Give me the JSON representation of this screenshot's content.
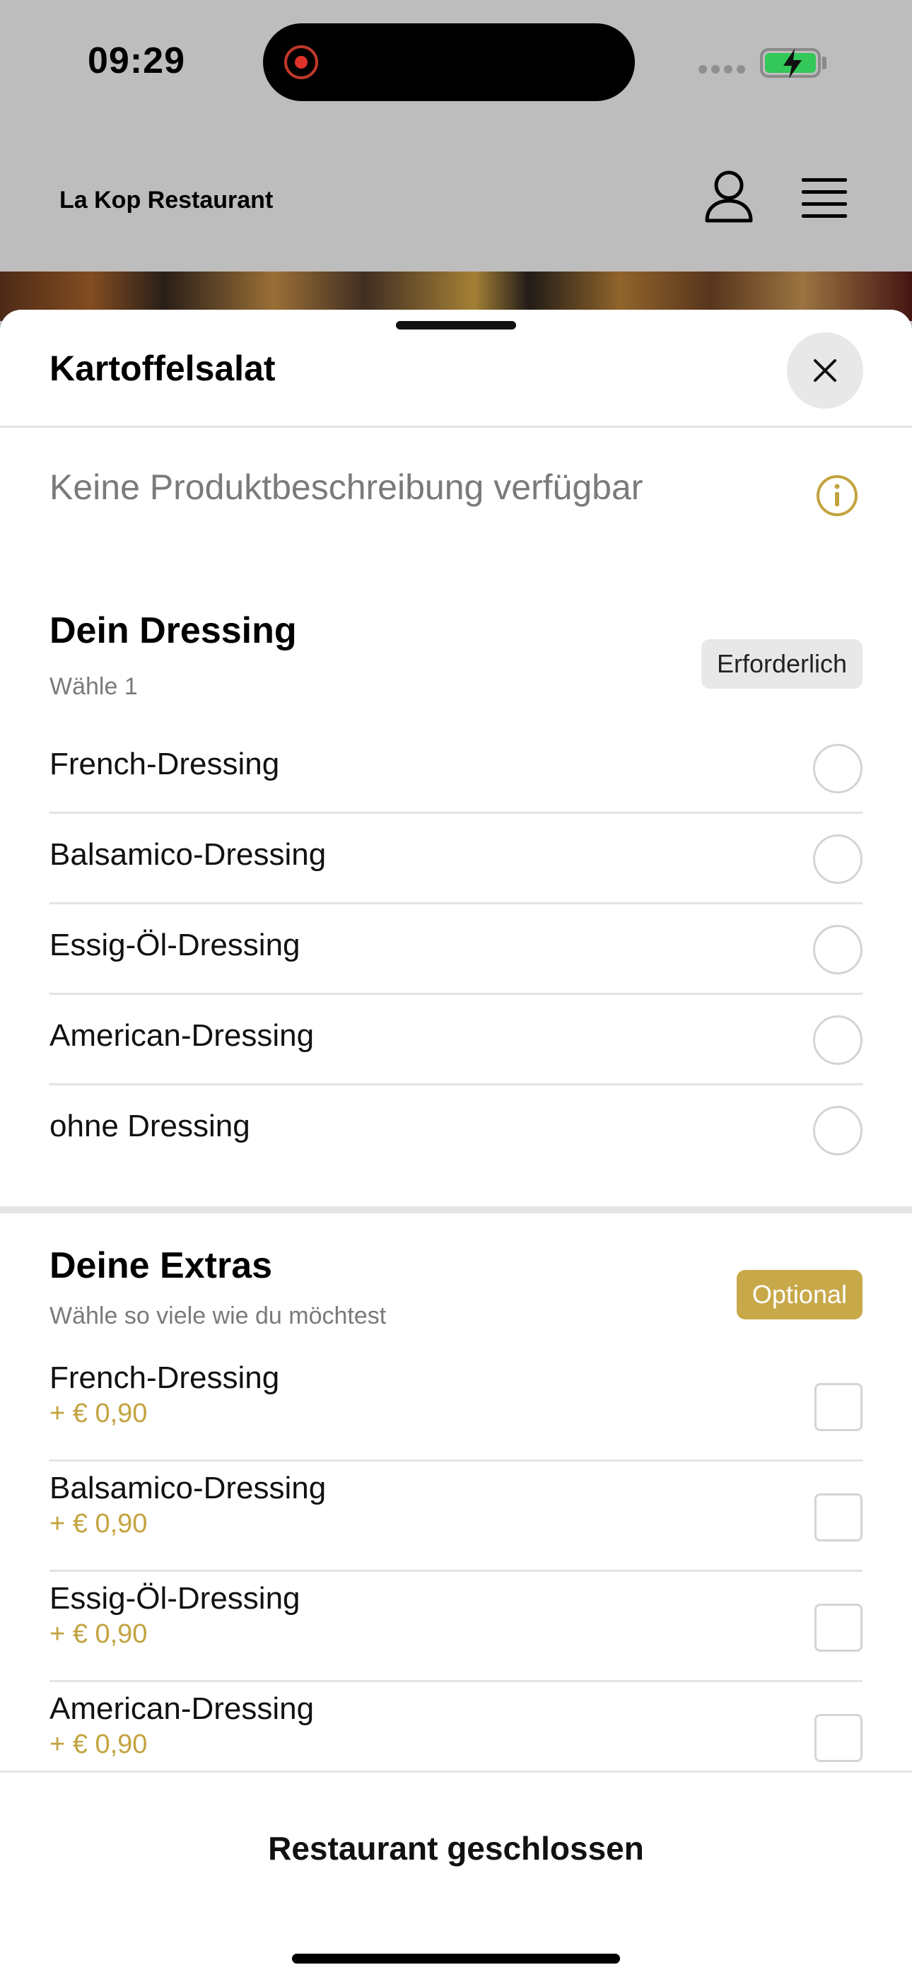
{
  "status_bar": {
    "time": "09:29"
  },
  "header": {
    "restaurant_name": "La Kop Restaurant",
    "user_icon": "user-icon",
    "menu_icon": "hamburger-menu-icon"
  },
  "sheet": {
    "title": "Kartoffelsalat",
    "close_icon": "close-icon",
    "description": "Keine Produktbeschreibung verfügbar",
    "info_icon": "info-icon"
  },
  "dressing_section": {
    "title": "Dein Dressing",
    "subtitle": "Wähle 1",
    "badge": "Erforderlich",
    "options": [
      {
        "label": "French-Dressing",
        "selected": false
      },
      {
        "label": "Balsamico-Dressing",
        "selected": false
      },
      {
        "label": "Essig-Öl-Dressing",
        "selected": false
      },
      {
        "label": "American-Dressing",
        "selected": false
      },
      {
        "label": "ohne Dressing",
        "selected": false
      }
    ]
  },
  "extras_section": {
    "title": "Deine Extras",
    "subtitle": "Wähle so viele wie du möchtest",
    "badge": "Optional",
    "options": [
      {
        "label": "French-Dressing",
        "price": "+ € 0,90",
        "checked": false
      },
      {
        "label": "Balsamico-Dressing",
        "price": "+ € 0,90",
        "checked": false
      },
      {
        "label": "Essig-Öl-Dressing",
        "price": "+ € 0,90",
        "checked": false
      },
      {
        "label": "American-Dressing",
        "price": "+ € 0,90",
        "checked": false
      }
    ]
  },
  "footer": {
    "cta_label": "Restaurant geschlossen"
  },
  "colors": {
    "accent_gold": "#c8a94a",
    "price_gold": "#c3a33f",
    "battery_green": "#34c759",
    "recording_red": "#e0322b"
  }
}
